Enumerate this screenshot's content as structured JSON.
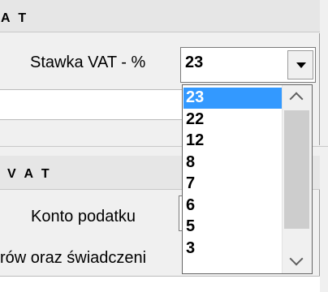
{
  "group1": {
    "title": "A T",
    "label": "Stawka VAT - %",
    "combo_value": "23"
  },
  "dropdown": {
    "options": [
      "23",
      "22",
      "12",
      "8",
      "7",
      "6",
      "5",
      "3"
    ],
    "selected": "23"
  },
  "group2": {
    "title": "V A T",
    "label": "Konto podatku",
    "description": "rów oraz świadczeni"
  },
  "colors": {
    "selection": "#3399ff",
    "panel": "#f0f0f0",
    "header": "#e6e6e6"
  },
  "icons": {
    "combo_button": "chevron-down-icon",
    "scroll_up": "chevron-up-icon",
    "scroll_down": "chevron-down-icon"
  }
}
